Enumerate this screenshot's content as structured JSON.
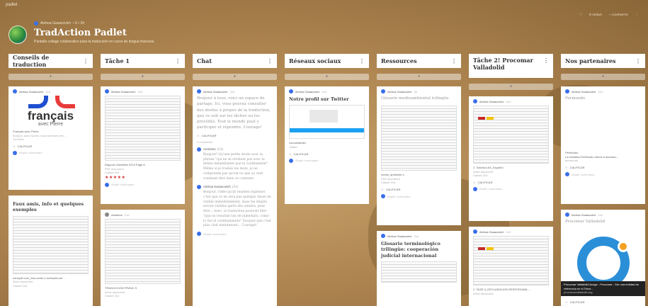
{
  "header": {
    "brand": "padlet",
    "author": "Ainhoa Gusacovich",
    "stats": "• 6 • 2h",
    "title": "TradAction Padlet",
    "subtitle": "Pantalla collage colaborativo para la traducción en curso de lengua francesa",
    "actions": [
      "♡",
      "⊡ SEÑAR",
      "+ COMPARTIR",
      "⋮"
    ]
  },
  "columns": [
    {
      "title": "Conseils de traduction",
      "cards": [
        {
          "author": "Ainhoa Gusacovich",
          "time": "11d",
          "logo_text": "français",
          "logo_sub": "avec Pierre",
          "title": "Français avec Pierre",
          "desc": "Bonjour, avec Noemi, nous sommes très ...",
          "source": "YouTube",
          "action": "CALIFICAR",
          "comment": "Añadir comentario"
        },
        {
          "title": "Faux amis, info et quelques exemples",
          "file": "nanopdf.com_faux-amis-1-exemples-se...",
          "source": "Word document",
          "time": "Cadsel 21d"
        }
      ]
    },
    {
      "title": "Tâche 1",
      "cards": [
        {
          "author": "Ainhoa Gusacovich",
          "time": "21d",
          "file": "Rapport d'activités 2019 Page 8",
          "source": "PDF document",
          "time2": "Cadsel 21d",
          "stars": "★★★★★",
          "comment": "Añadir comentario"
        },
        {
          "author": "Anónimo",
          "time": "21d",
          "file": "TRADUCCIÓN FRANC S",
          "source": "Word document",
          "time2": "Cadsel 21d"
        }
      ]
    },
    {
      "title": "Chat",
      "cards": [
        {
          "author": "Ainhoa Gusacovich",
          "time": "21d",
          "body": "Bonjour à tous, voici un espace de partage. Ici, vous pouvez consulter des doutes à propos de la traduction, que ce soit sur les tâches ou les procédés. Tout le monde peut y participer et répondre. Courage!",
          "action": "CALIFICAR",
          "comments_count": "2 comments",
          "replies": [
            {
              "name": "Anónimo",
              "time": "21d",
              "text": "Bonjour! Qu'une petite doute avec la phrase \"qui ne se révèlent pas avec la même immédiateté que le confinement\". Même si je traduis les mots, je ne comprends pas qu'est-ce que ça veut vraiment dire dans ce contexte."
            },
            {
              "name": "Ainhoa Gusacovich",
              "time": "21d",
              "text": "Bonjour, l'idée qu'ils tendent exprimer c'est que ce ne sera pas quelque chose de visible immédiatement, mais les dégâts seront visibles après des années, peut être... donc, la traduction pourrait être \"que no resultan tan de inmediato, como lo fue el confinamiento\" Essayez que c'est plus clair maintenant... Courage!"
            }
          ],
          "comment": "Añadir comentario"
        }
      ]
    },
    {
      "title": "Réseaux sociaux",
      "cards": [
        {
          "author": "Ainhoa Gusacovich",
          "time": "11d",
          "title": "Notre profil sur Twitter",
          "file": "courseladolid",
          "source": "Twitter",
          "action": "CALIFICAR",
          "comment": "Añadir comentario"
        }
      ]
    },
    {
      "title": "Ressources",
      "cards": [
        {
          "author": "Ainhoa Gusacovich",
          "time": "5h",
          "title": "Glosario medioambiental trilingüe",
          "file": "medio_ambiente e",
          "source": "PDF document",
          "time2": "Cadsel 21d",
          "action": "CALIFICAR",
          "comment": "Añadir comentario"
        },
        {
          "author": "Ainhoa Gusacovich",
          "time": "21d",
          "title": "Glosario terminológico trilingüe: cooperación judicial internacional"
        }
      ]
    },
    {
      "title": "Tâche 2! Procomar Valladolid",
      "cards": [
        {
          "author": "Ainhoa Gusacovich",
          "time": "11d",
          "file": "2. Solicitud AS_Español",
          "source": "Word document",
          "time2": "Cadsel 21d",
          "action": "CALIFICAR",
          "comment": "Añadir comentario"
        },
        {
          "author": "Ainhoa Gusacovich",
          "time": "11d",
          "file": "2. FASE II_DECLARACION RESPONSABL...",
          "source": "Word document",
          "time2": "Cadsel 21d"
        }
      ]
    },
    {
      "title": "Nos partenaires",
      "cards": [
        {
          "author": "Ainhoa Gusacovich",
          "time": "11d",
          "body": "Permondo",
          "file": "PerMondo",
          "desc": "La iniciativa PerMondo ofrece a asociaci...",
          "source": "permondo",
          "action": "CALIFICAR",
          "comment": "Añadir comentario"
        },
        {
          "author": "Ainhoa Gusacovich",
          "time": "11d",
          "body": "Procomar Valladolid",
          "banner": "Procomar Valladolid Acoge - Procomar - Ser una entidad de referencia en el Terce...",
          "banner_src": "procomarvalladolid.org",
          "action": "CALIFICAR"
        }
      ]
    }
  ]
}
